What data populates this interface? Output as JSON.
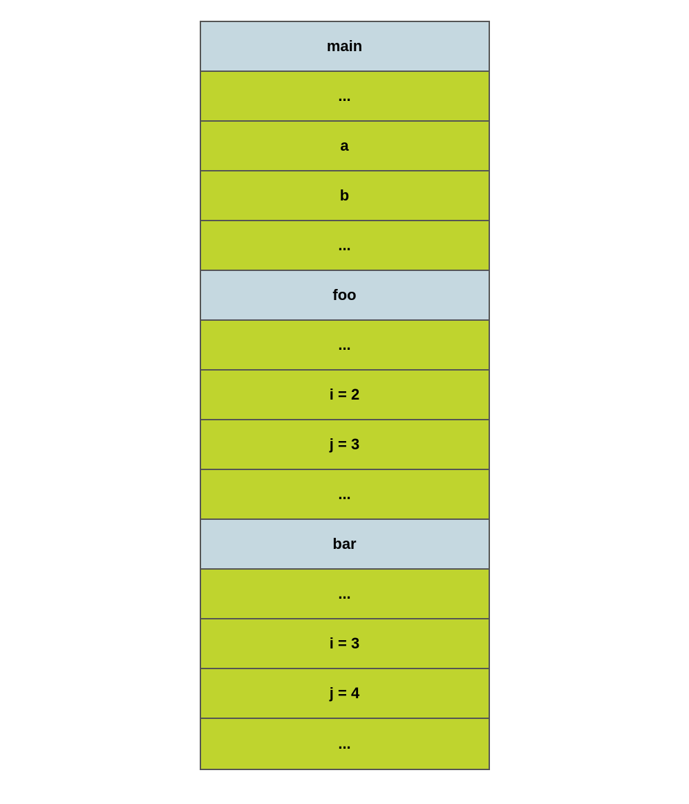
{
  "rows": [
    {
      "label": "main",
      "type": "header"
    },
    {
      "label": "...",
      "type": "body"
    },
    {
      "label": "a",
      "type": "body"
    },
    {
      "label": "b",
      "type": "body"
    },
    {
      "label": "...",
      "type": "body"
    },
    {
      "label": "foo",
      "type": "header"
    },
    {
      "label": "...",
      "type": "body"
    },
    {
      "label": "i = 2",
      "type": "body"
    },
    {
      "label": "j = 3",
      "type": "body"
    },
    {
      "label": "...",
      "type": "body"
    },
    {
      "label": "bar",
      "type": "header"
    },
    {
      "label": "...",
      "type": "body"
    },
    {
      "label": "i = 3",
      "type": "body"
    },
    {
      "label": "j = 4",
      "type": "body"
    },
    {
      "label": "...",
      "type": "body"
    }
  ],
  "colors": {
    "header_bg": "#c5d8e0",
    "body_bg": "#bfd42e",
    "border": "#555555"
  }
}
